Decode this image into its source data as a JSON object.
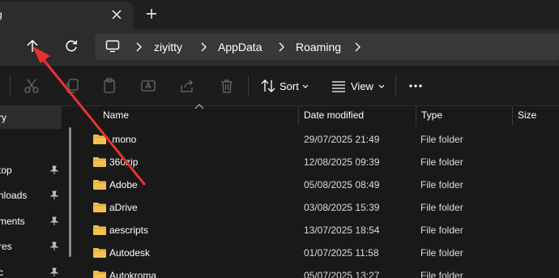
{
  "window": {
    "tab_title": "g"
  },
  "breadcrumb": [
    "ziyitty",
    "AppData",
    "Roaming"
  ],
  "toolbar": {
    "sort_label": "Sort",
    "view_label": "View"
  },
  "sidebar": {
    "items": [
      {
        "label": "ry",
        "selected": true,
        "pinned": false
      },
      {
        "label": "top",
        "pinned": true
      },
      {
        "label": "nloads",
        "pinned": true
      },
      {
        "label": "ments",
        "pinned": true
      },
      {
        "label": "res",
        "pinned": true
      },
      {
        "label": "c",
        "pinned": true
      }
    ]
  },
  "columns": {
    "name": "Name",
    "date": "Date modified",
    "type": "Type",
    "size": "Size"
  },
  "files": [
    {
      "name": ".mono",
      "date": "29/07/2025 21:49",
      "type": "File folder"
    },
    {
      "name": "360zip",
      "date": "12/08/2025 09:39",
      "type": "File folder"
    },
    {
      "name": "Adobe",
      "date": "05/08/2025 08:49",
      "type": "File folder"
    },
    {
      "name": "aDrive",
      "date": "03/08/2025 15:39",
      "type": "File folder"
    },
    {
      "name": "aescripts",
      "date": "13/07/2025 18:54",
      "type": "File folder"
    },
    {
      "name": "Autodesk",
      "date": "01/07/2025 11:58",
      "type": "File folder"
    },
    {
      "name": "Autokroma",
      "date": "05/07/2025 13:27",
      "type": "File folder"
    }
  ],
  "colors": {
    "folder": "#f2c14e",
    "annotation_arrow": "#e8322c"
  }
}
